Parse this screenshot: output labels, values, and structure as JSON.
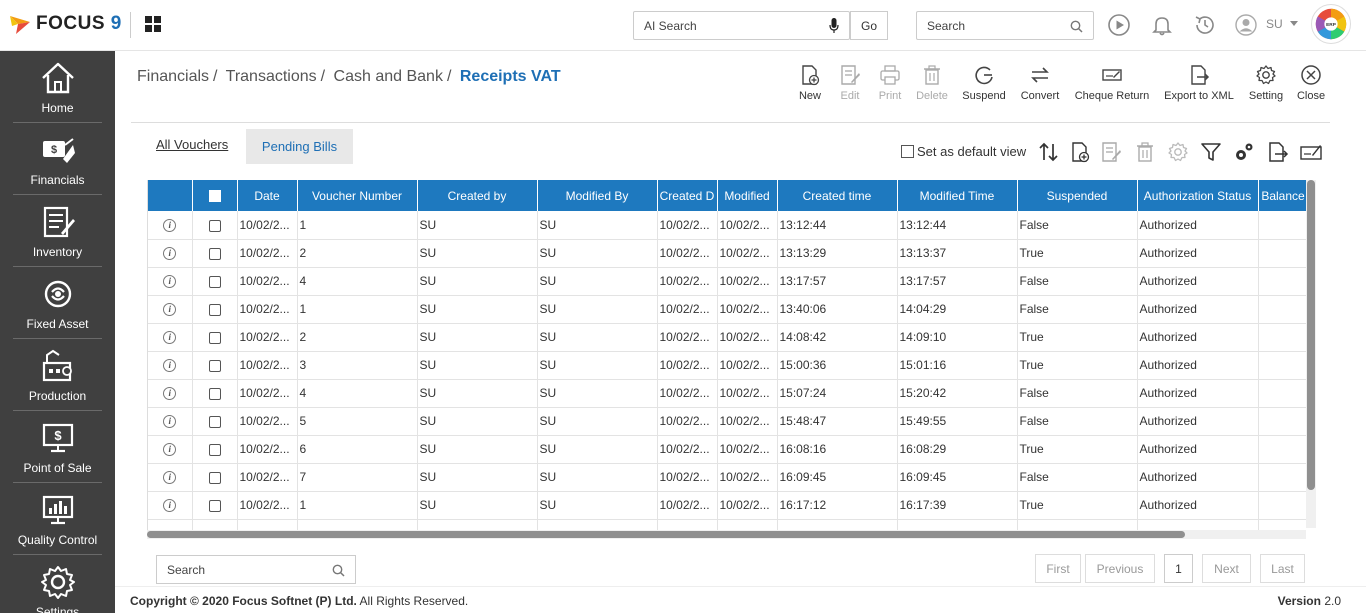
{
  "header": {
    "logo_text": "FOCUS",
    "logo_num": "9",
    "ai_search_placeholder": "AI Search",
    "go_label": "Go",
    "search_placeholder": "Search",
    "user": "SU",
    "erp_badge": "ERP"
  },
  "sidebar": {
    "items": [
      {
        "label": "Home",
        "icon": "home-icon"
      },
      {
        "label": "Financials",
        "icon": "financials-icon"
      },
      {
        "label": "Inventory",
        "icon": "inventory-icon"
      },
      {
        "label": "Fixed Asset",
        "icon": "fixed-asset-icon"
      },
      {
        "label": "Production",
        "icon": "production-icon"
      },
      {
        "label": "Point of Sale",
        "icon": "point-of-sale-icon"
      },
      {
        "label": "Quality Control",
        "icon": "quality-control-icon"
      },
      {
        "label": "Settings",
        "icon": "settings-icon"
      }
    ]
  },
  "breadcrumb": {
    "items": [
      "Financials",
      "Transactions",
      "Cash and Bank"
    ],
    "current": "Receipts VAT"
  },
  "toolbar": {
    "new": "New",
    "edit": "Edit",
    "print": "Print",
    "delete": "Delete",
    "suspend": "Suspend",
    "convert": "Convert",
    "cheque_return": "Cheque Return",
    "export_xml": "Export to XML",
    "setting": "Setting",
    "close": "Close"
  },
  "tabs": {
    "all": "All Vouchers",
    "pending": "Pending Bills"
  },
  "default_view_label": "Set as default view",
  "grid": {
    "columns": [
      "Date",
      "Voucher Number",
      "Created by",
      "Modified By",
      "Created D",
      "Modified",
      "Created time",
      "Modified Time",
      "Suspended",
      "Authorization Status",
      "Balance"
    ],
    "rows": [
      {
        "date": "10/02/2...",
        "vno": "1",
        "cby": "SU",
        "mby": "SU",
        "cdate": "10/02/2...",
        "mdate": "10/02/2...",
        "ctime": "13:12:44",
        "mtime": "13:12:44",
        "susp": "False",
        "auth": "Authorized"
      },
      {
        "date": "10/02/2...",
        "vno": "2",
        "cby": "SU",
        "mby": "SU",
        "cdate": "10/02/2...",
        "mdate": "10/02/2...",
        "ctime": "13:13:29",
        "mtime": "13:13:37",
        "susp": "True",
        "auth": "Authorized"
      },
      {
        "date": "10/02/2...",
        "vno": "4",
        "cby": "SU",
        "mby": "SU",
        "cdate": "10/02/2...",
        "mdate": "10/02/2...",
        "ctime": "13:17:57",
        "mtime": "13:17:57",
        "susp": "False",
        "auth": "Authorized"
      },
      {
        "date": "10/02/2...",
        "vno": "1",
        "cby": "SU",
        "mby": "SU",
        "cdate": "10/02/2...",
        "mdate": "10/02/2...",
        "ctime": "13:40:06",
        "mtime": "14:04:29",
        "susp": "False",
        "auth": "Authorized"
      },
      {
        "date": "10/02/2...",
        "vno": "2",
        "cby": "SU",
        "mby": "SU",
        "cdate": "10/02/2...",
        "mdate": "10/02/2...",
        "ctime": "14:08:42",
        "mtime": "14:09:10",
        "susp": "True",
        "auth": "Authorized"
      },
      {
        "date": "10/02/2...",
        "vno": "3",
        "cby": "SU",
        "mby": "SU",
        "cdate": "10/02/2...",
        "mdate": "10/02/2...",
        "ctime": "15:00:36",
        "mtime": "15:01:16",
        "susp": "True",
        "auth": "Authorized"
      },
      {
        "date": "10/02/2...",
        "vno": "4",
        "cby": "SU",
        "mby": "SU",
        "cdate": "10/02/2...",
        "mdate": "10/02/2...",
        "ctime": "15:07:24",
        "mtime": "15:20:42",
        "susp": "False",
        "auth": "Authorized"
      },
      {
        "date": "10/02/2...",
        "vno": "5",
        "cby": "SU",
        "mby": "SU",
        "cdate": "10/02/2...",
        "mdate": "10/02/2...",
        "ctime": "15:48:47",
        "mtime": "15:49:55",
        "susp": "False",
        "auth": "Authorized"
      },
      {
        "date": "10/02/2...",
        "vno": "6",
        "cby": "SU",
        "mby": "SU",
        "cdate": "10/02/2...",
        "mdate": "10/02/2...",
        "ctime": "16:08:16",
        "mtime": "16:08:29",
        "susp": "True",
        "auth": "Authorized"
      },
      {
        "date": "10/02/2...",
        "vno": "7",
        "cby": "SU",
        "mby": "SU",
        "cdate": "10/02/2...",
        "mdate": "10/02/2...",
        "ctime": "16:09:45",
        "mtime": "16:09:45",
        "susp": "False",
        "auth": "Authorized"
      },
      {
        "date": "10/02/2...",
        "vno": "1",
        "cby": "SU",
        "mby": "SU",
        "cdate": "10/02/2...",
        "mdate": "10/02/2...",
        "ctime": "16:17:12",
        "mtime": "16:17:39",
        "susp": "True",
        "auth": "Authorized"
      }
    ]
  },
  "grid_search_placeholder": "Search",
  "pager": {
    "first": "First",
    "previous": "Previous",
    "page": "1",
    "next": "Next",
    "last": "Last"
  },
  "footer": {
    "copyright_prefix": "Copyright © 2020 Focus Softnet (P) Ltd.",
    "copyright_suffix": " All Rights Reserved.",
    "version_label": "Version",
    "version_number": "2.0"
  },
  "colors": {
    "accent": "#1e79bf",
    "sidebar": "#404040",
    "link": "#1e6fb5"
  }
}
